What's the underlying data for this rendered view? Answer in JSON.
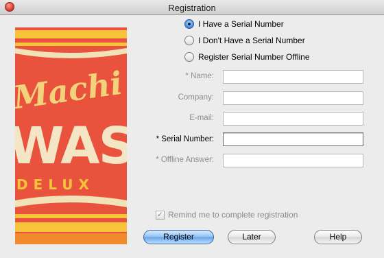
{
  "window": {
    "title": "Registration"
  },
  "art": {
    "words": [
      "Machi",
      "WAS",
      "DELUX"
    ],
    "colors": {
      "red": "#e9523d",
      "yellow": "#f6c33b",
      "cream": "#f2e2b8",
      "orange": "#f08a2c"
    }
  },
  "options": [
    {
      "label": "I Have a Serial Number",
      "selected": true
    },
    {
      "label": "I Don't Have a Serial Number",
      "selected": false
    },
    {
      "label": "Register Serial Number Offline",
      "selected": false
    }
  ],
  "form": {
    "name_label": "* Name:",
    "company_label": "Company:",
    "email_label": "E-mail:",
    "serial_label": "* Serial Number:",
    "offline_label": "* Offline Answer:",
    "name_value": "",
    "company_value": "",
    "email_value": "",
    "serial_value": "",
    "offline_value": ""
  },
  "remind": {
    "label": "Remind me to complete registration",
    "checked": true
  },
  "buttons": {
    "register": "Register",
    "later": "Later",
    "help": "Help"
  },
  "colors": {
    "accent": "#3f86d8",
    "disabled_text": "#8d8d8d"
  }
}
